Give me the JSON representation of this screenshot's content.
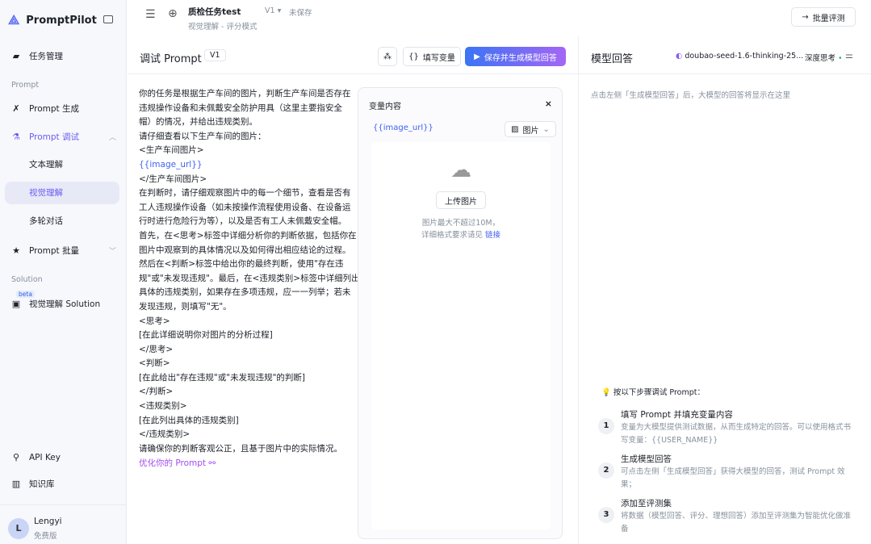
{
  "sidebar": {
    "brand": "PromptPilot",
    "task_mgmt": "任务管理",
    "section_prompt": "Prompt",
    "prompt_gen": "Prompt 生成",
    "prompt_debug": "Prompt 调试",
    "sub_text": "文本理解",
    "sub_vision": "视觉理解",
    "sub_multi": "多轮对话",
    "prompt_batch": "Prompt 批量",
    "section_solution": "Solution",
    "beta": "beta",
    "vision_solution": "视觉理解 Solution",
    "api_key": "API Key",
    "knowledge": "知识库",
    "user_name": "Lengyi",
    "user_plan": "免费版",
    "user_initial": "L"
  },
  "topbar": {
    "task_title": "质检任务test",
    "version": "V1",
    "save_state": "未保存",
    "subtitle": "视觉理解 - 评分模式",
    "batch_eval": "批量评测"
  },
  "debug": {
    "title": "调试 Prompt",
    "version": "V1",
    "fill_vars": "填写变量",
    "save_generate": "保存并生成模型回答",
    "prompt_lines": [
      "你的任务是根据生产车间的图片，判断生产车间是否存在",
      "违规操作设备和未佩戴安全防护用具（这里主要指安全",
      "帽）的情况，并给出违规类别。",
      "请仔细查看以下生产车间的图片：",
      "<生产车间图片>",
      "{{image_url}}",
      "</生产车间图片>",
      "在判断时，请仔细观察图片中的每一个细节，查看是否有",
      "工人违规操作设备（如未按操作流程使用设备、在设备运",
      "行时进行危险行为等），以及是否有工人未佩戴安全帽。",
      "首先，在<思考>标签中详细分析你的判断依据，包括你在",
      "图片中观察到的具体情况以及如何得出相应结论的过程。",
      "然后在<判断>标签中给出你的最终判断，使用\"存在违",
      "规\"或\"未发现违规\"。最后，在<违规类别>标签中详细列出",
      "具体的违规类别，如果存在多项违规，应一一列举；若未",
      "发现违规，则填写\"无\"。",
      "<思考>",
      "[在此详细说明你对图片的分析过程]",
      "</思考>",
      "<判断>",
      "[在此给出\"存在违规\"或\"未发现违规\"的判断]",
      "</判断>",
      "<违规类别>",
      "[在此列出具体的违规类别]",
      "</违规类别>",
      "请确保你的判断客观公正，且基于图片中的实际情况。"
    ],
    "optimize": "优化你的 Prompt"
  },
  "variables": {
    "title": "变量内容",
    "var_name": "{{image_url}}",
    "type": "图片",
    "upload": "上传图片",
    "hint1": "图片最大不超过10M，",
    "hint2": "详细格式要求请见",
    "link": "链接"
  },
  "answer": {
    "title": "模型回答",
    "model": "doubao-seed-1.6-thinking-25...",
    "deep_think": "深度思考",
    "placeholder": "点击左侧「生成模型回答」后，大模型的回答将显示在这里",
    "guide": "按以下步骤调试 Prompt：",
    "steps": [
      {
        "n": "1",
        "title": "填写 Prompt 并填充变量内容",
        "desc": "变量为大模型提供测试数据，从而生成特定的回答。可以使用格式书写变量：{{USER_NAME}}"
      },
      {
        "n": "2",
        "title": "生成模型回答",
        "desc": "可点击左侧「生成模型回答」获得大模型的回答，测试 Prompt 效果；"
      },
      {
        "n": "3",
        "title": "添加至评测集",
        "desc": "将数据（模型回答、评分、理想回答）添加至评测集为智能优化做准备"
      }
    ]
  }
}
